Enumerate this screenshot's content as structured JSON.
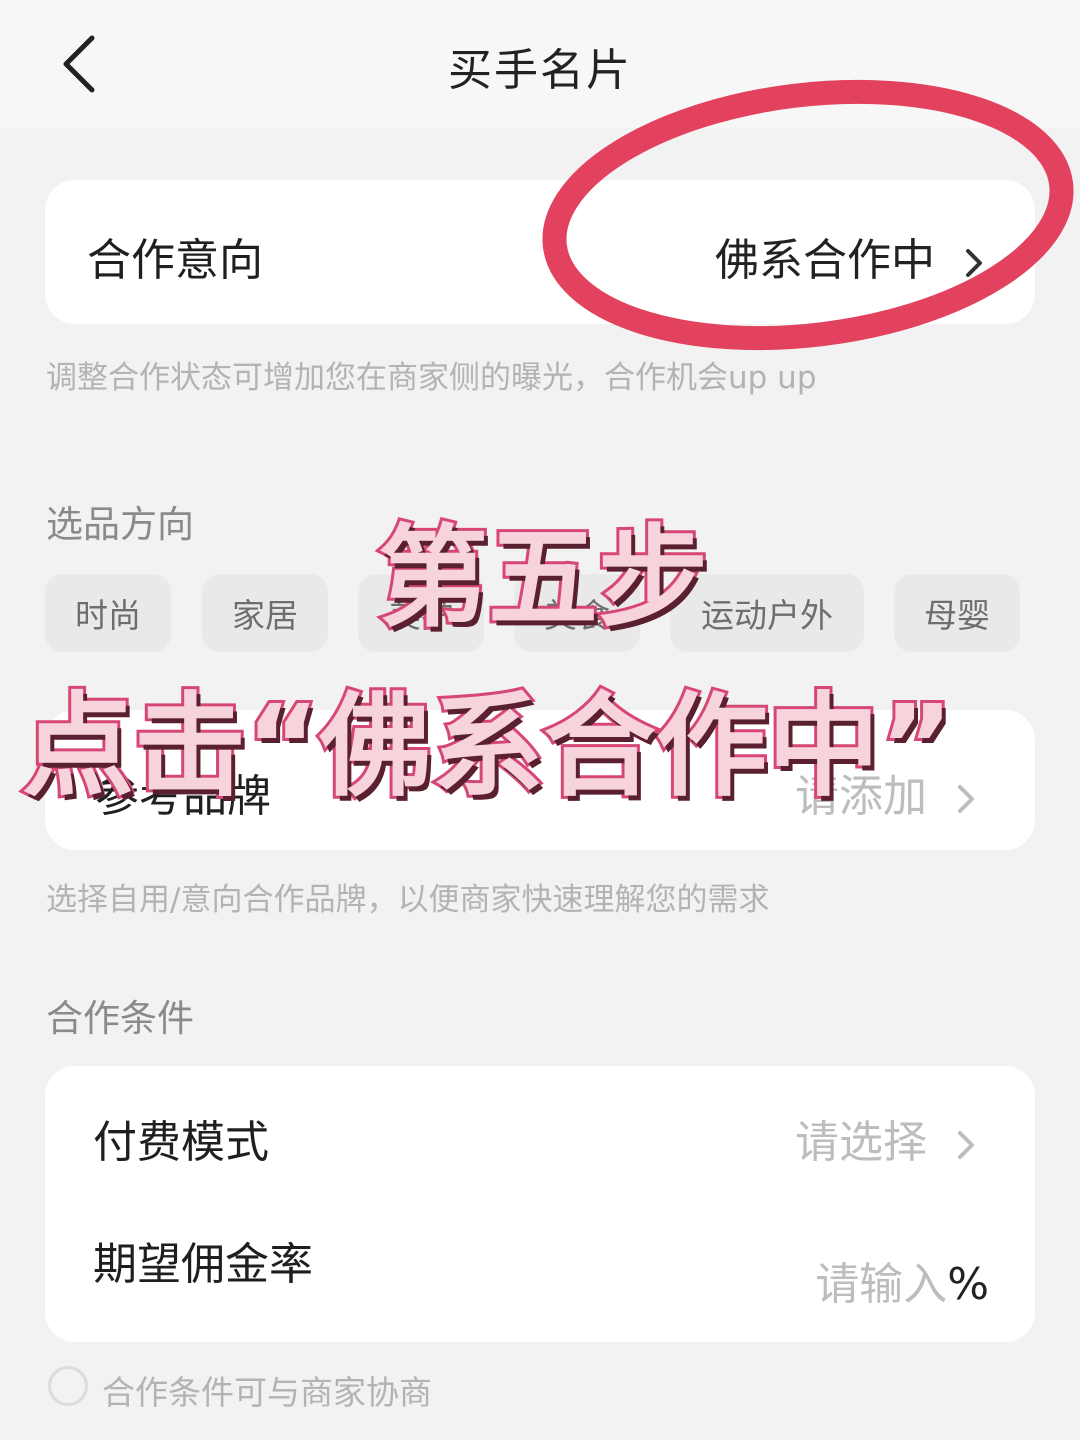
{
  "header": {
    "title": "买手名片"
  },
  "cooperation": {
    "label": "合作意向",
    "value": "佛系合作中",
    "hint": "调整合作状态可增加您在商家侧的曝光，合作机会up up"
  },
  "selection": {
    "section_title": "选品方向",
    "chips": [
      "时尚",
      "家居",
      "美护",
      "美食",
      "运动户外",
      "母婴"
    ]
  },
  "brands": {
    "label": "参考品牌",
    "value": "请添加",
    "hint": "选择自用/意向合作品牌，以便商家快速理解您的需求"
  },
  "conditions": {
    "section_title": "合作条件",
    "payment_label": "付费模式",
    "payment_value": "请选择",
    "commission_label": "期望佣金率",
    "commission_placeholder": "请输入",
    "commission_unit": "%",
    "negotiable_label": "合作条件可与商家协商"
  },
  "annotation": {
    "step": "第五步",
    "instruction": "点击“佛系合作中”",
    "circle_color": "#e3425e",
    "text_color": "#f7d3db",
    "stroke_color": "#d64777"
  },
  "icons": {
    "back": "chevron-left-icon",
    "row_arrow": "chevron-right-icon"
  }
}
